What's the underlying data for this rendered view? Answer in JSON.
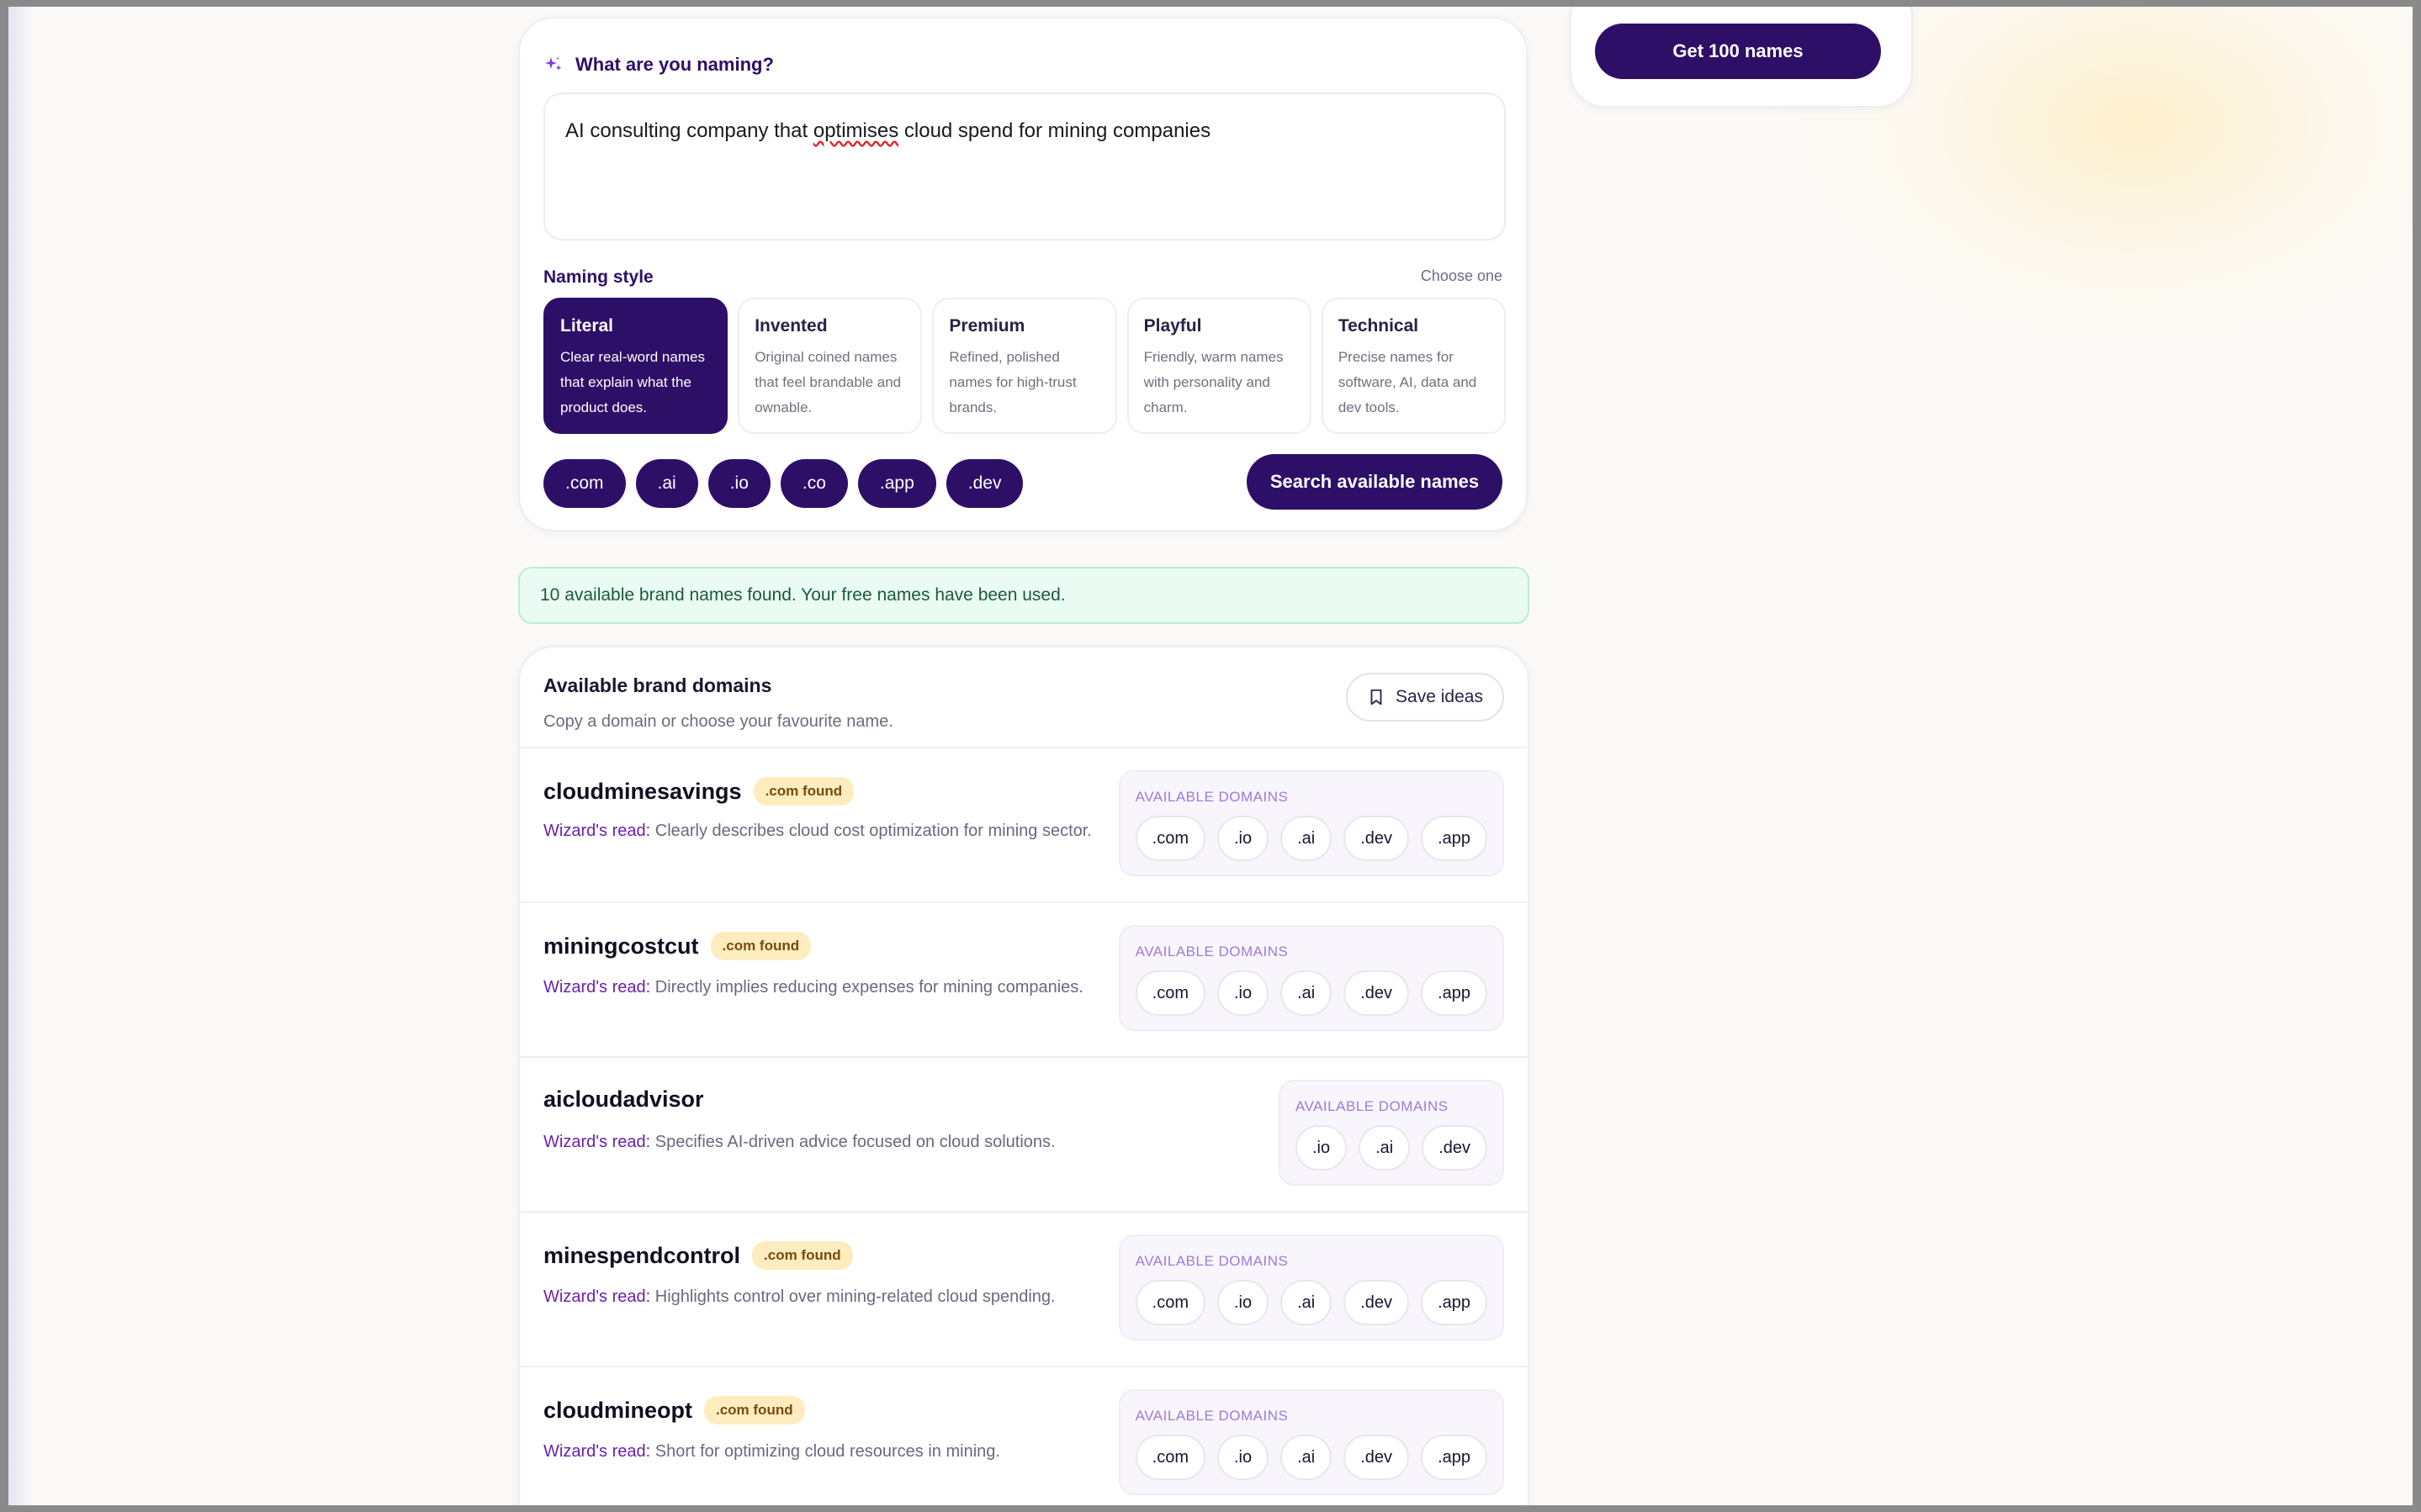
{
  "form": {
    "question": "What are you naming?",
    "prompt_value": [
      "AI consulting company that ",
      "optimises",
      " cloud spend for mining companies"
    ],
    "style_label": "Naming style",
    "choose_one": "Choose one",
    "styles": [
      {
        "title": "Literal",
        "desc": "Clear real-word names that explain what the product does.",
        "selected": true
      },
      {
        "title": "Invented",
        "desc": "Original coined names that feel brandable and ownable.",
        "selected": false
      },
      {
        "title": "Premium",
        "desc": "Refined, polished names for high-trust brands.",
        "selected": false
      },
      {
        "title": "Playful",
        "desc": "Friendly, warm names with personality and charm.",
        "selected": false
      },
      {
        "title": "Technical",
        "desc": "Precise names for software, AI, data and dev tools.",
        "selected": false
      }
    ],
    "tlds": [
      ".com",
      ".ai",
      ".io",
      ".co",
      ".app",
      ".dev"
    ],
    "search_label": "Search available names"
  },
  "side": {
    "get_label": "Get 100 names"
  },
  "notice": "10 available brand names found. Your free names have been used.",
  "results": {
    "title": "Available brand domains",
    "subtitle": "Copy a domain or choose your favourite name.",
    "save_label": "Save ideas",
    "wizard_prefix": "Wizard's read:",
    "domains_label": "AVAILABLE DOMAINS",
    "items": [
      {
        "name": "cloudminesavings",
        "badge": ".com found",
        "read": "Clearly describes cloud cost optimization for mining sector.",
        "domains": [
          ".com",
          ".io",
          ".ai",
          ".dev",
          ".app"
        ]
      },
      {
        "name": "miningcostcut",
        "badge": ".com found",
        "read": "Directly implies reducing expenses for mining companies.",
        "domains": [
          ".com",
          ".io",
          ".ai",
          ".dev",
          ".app"
        ]
      },
      {
        "name": "aicloudadvisor",
        "badge": "",
        "read": "Specifies AI-driven advice focused on cloud solutions.",
        "domains": [
          ".io",
          ".ai",
          ".dev"
        ]
      },
      {
        "name": "minespendcontrol",
        "badge": ".com found",
        "read": "Highlights control over mining-related cloud spending.",
        "domains": [
          ".com",
          ".io",
          ".ai",
          ".dev",
          ".app"
        ]
      },
      {
        "name": "cloudmineopt",
        "badge": ".com found",
        "read": "Short for optimizing cloud resources in mining.",
        "domains": [
          ".com",
          ".io",
          ".ai",
          ".dev",
          ".app"
        ]
      }
    ]
  },
  "colors": {
    "brand": "#2e0f68",
    "accent": "#6a1fb0",
    "badge_bg": "#fdecbe",
    "success_bg": "#e9fbf3"
  }
}
